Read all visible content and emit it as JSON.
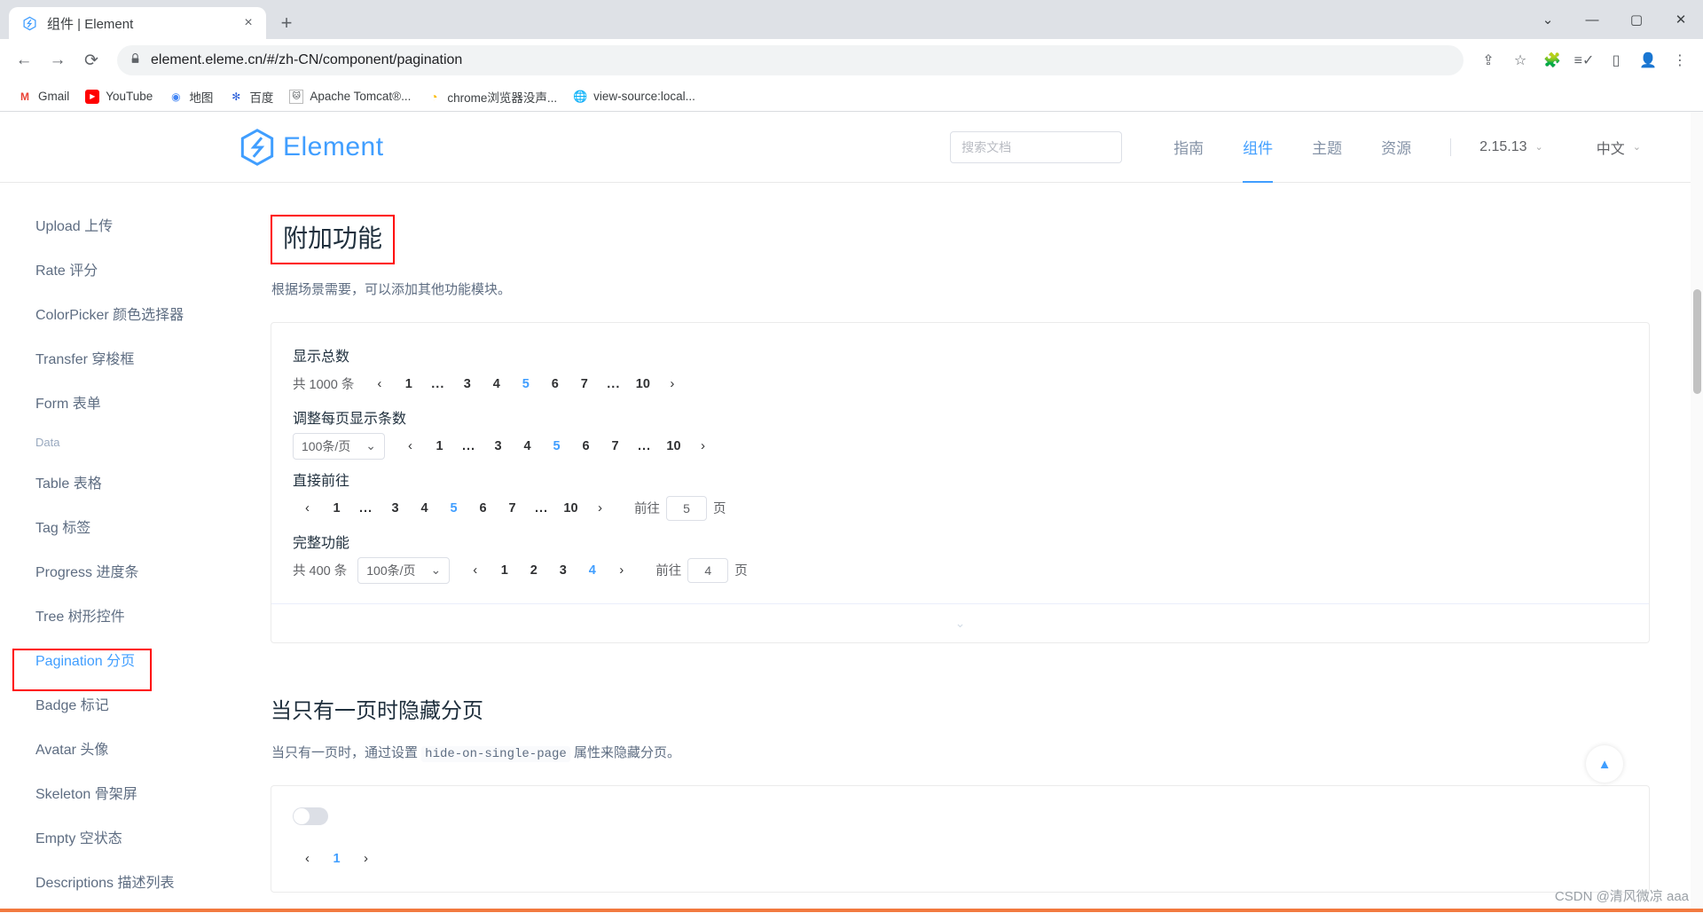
{
  "browser": {
    "tab": {
      "title": "组件 | Element",
      "favicon_icon": "element-logo-icon",
      "close_icon": "×"
    },
    "newtab_label": "+",
    "window_controls": {
      "minimize": "—",
      "maximize": "▢",
      "close": "✕",
      "more_tabs": "⌄"
    },
    "nav": {
      "back": "←",
      "forward": "→",
      "reload": "⟳"
    },
    "omnibox": {
      "lock_icon": "lock-icon",
      "url": "element.eleme.cn/#/zh-CN/component/pagination",
      "share_icon": "⇪",
      "star_icon": "☆"
    },
    "toolbar_icons": {
      "extensions": "🧩",
      "reading_list": "≡✓",
      "side_panel": "▯",
      "profile": "👤",
      "menu": "⋮"
    },
    "bookmarks": [
      {
        "label": "Gmail",
        "icon": "M"
      },
      {
        "label": "YouTube",
        "icon": "▶"
      },
      {
        "label": "地图",
        "icon": "◉"
      },
      {
        "label": "百度",
        "icon": "✻"
      },
      {
        "label": "Apache Tomcat®...",
        "icon": "🐱"
      },
      {
        "label": "chrome浏览器没声...",
        "icon": "◔"
      },
      {
        "label": "view-source:local...",
        "icon": "🌐"
      }
    ]
  },
  "site": {
    "logo_text": "Element",
    "search": {
      "placeholder": "搜索文档",
      "value": ""
    },
    "nav": [
      {
        "label": "指南",
        "active": false
      },
      {
        "label": "组件",
        "active": true
      },
      {
        "label": "主题",
        "active": false
      },
      {
        "label": "资源",
        "active": false
      }
    ],
    "version": {
      "value": "2.15.13",
      "caret": "⌄"
    },
    "language": {
      "value": "中文",
      "caret": "⌄"
    }
  },
  "sidebar": {
    "items": [
      {
        "label": "Upload 上传",
        "type": "item",
        "active": false
      },
      {
        "label": "Rate 评分",
        "type": "item",
        "active": false
      },
      {
        "label": "ColorPicker 颜色选择器",
        "type": "item",
        "active": false
      },
      {
        "label": "Transfer 穿梭框",
        "type": "item",
        "active": false
      },
      {
        "label": "Form 表单",
        "type": "item",
        "active": false
      },
      {
        "label": "Data",
        "type": "group",
        "active": false
      },
      {
        "label": "Table 表格",
        "type": "item",
        "active": false
      },
      {
        "label": "Tag 标签",
        "type": "item",
        "active": false
      },
      {
        "label": "Progress 进度条",
        "type": "item",
        "active": false
      },
      {
        "label": "Tree 树形控件",
        "type": "item",
        "active": false
      },
      {
        "label": "Pagination 分页",
        "type": "item",
        "active": true
      },
      {
        "label": "Badge 标记",
        "type": "item",
        "active": false
      },
      {
        "label": "Avatar 头像",
        "type": "item",
        "active": false
      },
      {
        "label": "Skeleton 骨架屏",
        "type": "item",
        "active": false
      },
      {
        "label": "Empty 空状态",
        "type": "item",
        "active": false
      },
      {
        "label": "Descriptions 描述列表",
        "type": "item",
        "active": false
      }
    ]
  },
  "main": {
    "section1": {
      "heading": "附加功能",
      "description": "根据场景需要，可以添加其他功能模块。",
      "demos": [
        {
          "label": "显示总数",
          "total_text": "共 1000 条",
          "prev": "‹",
          "pages": [
            "1",
            "...",
            "3",
            "4",
            "5",
            "6",
            "7",
            "...",
            "10"
          ],
          "current": "5",
          "next": "›"
        },
        {
          "label": "调整每页显示条数",
          "page_size": "100条/页",
          "page_size_caret": "⌄",
          "prev": "‹",
          "pages": [
            "1",
            "...",
            "3",
            "4",
            "5",
            "6",
            "7",
            "...",
            "10"
          ],
          "current": "5",
          "next": "›"
        },
        {
          "label": "直接前往",
          "prev": "‹",
          "pages": [
            "1",
            "...",
            "3",
            "4",
            "5",
            "6",
            "7",
            "...",
            "10"
          ],
          "current": "5",
          "next": "›",
          "jump_prefix": "前往",
          "jump_value": "5",
          "jump_suffix": "页"
        },
        {
          "label": "完整功能",
          "total_text": "共 400 条",
          "page_size": "100条/页",
          "page_size_caret": "⌄",
          "prev": "‹",
          "pages": [
            "1",
            "2",
            "3",
            "4"
          ],
          "current": "4",
          "next": "›",
          "jump_prefix": "前往",
          "jump_value": "4",
          "jump_suffix": "页"
        }
      ],
      "expand_icon": "⌄"
    },
    "section2": {
      "heading": "当只有一页时隐藏分页",
      "desc_before": "当只有一页时，通过设置 ",
      "code": "hide-on-single-page",
      "desc_after": " 属性来隐藏分页。",
      "switch_on": false,
      "prev": "‹",
      "pages": [
        "1"
      ],
      "current": "1",
      "next": "›"
    }
  },
  "backtop": {
    "icon": "▲"
  },
  "watermark": "CSDN @清风微凉 aaa",
  "colors": {
    "accent": "#409eff",
    "annotation": "#ff0000",
    "text": "#1f2f3d",
    "muted": "#5e6d82"
  }
}
